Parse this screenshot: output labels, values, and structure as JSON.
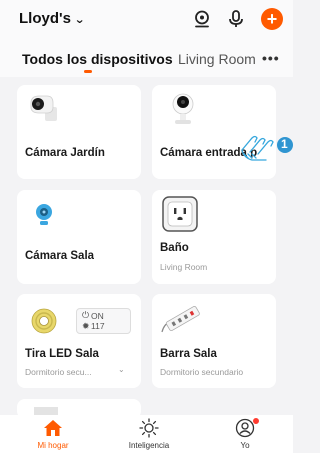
{
  "header": {
    "home_name": "Lloyd's",
    "icons": [
      "camera-icon",
      "mic-icon",
      "add-icon"
    ]
  },
  "tabs": [
    {
      "label": "Todos los dispositivos",
      "active": true
    },
    {
      "label": "Living Room",
      "active": false
    }
  ],
  "devices": [
    {
      "name": "Cámara Jardín",
      "room": "",
      "icon": "camera-outdoor-icon"
    },
    {
      "name": "Cámara entrada p",
      "room": "",
      "icon": "camera-indoor-icon"
    },
    {
      "name": "Cámara Sala",
      "room": "",
      "icon": "camera-dome-icon"
    },
    {
      "name": "Baño",
      "room": "Living Room",
      "icon": "smart-plug-icon"
    },
    {
      "name": "Tira LED Sala",
      "room": "Dormitorio secu...",
      "icon": "led-strip-icon",
      "status": "ON",
      "value": "117"
    },
    {
      "name": "Barra Sala",
      "room": "Dormitorio secundario",
      "icon": "power-strip-icon"
    }
  ],
  "hint": {
    "step": "1"
  },
  "bottom_nav": [
    {
      "label": "Mi hogar",
      "icon": "home-icon",
      "active": true
    },
    {
      "label": "Inteligencia",
      "icon": "sun-icon",
      "active": false
    },
    {
      "label": "Yo",
      "icon": "profile-icon",
      "active": false,
      "badge": true
    }
  ],
  "colors": {
    "accent": "#ff5a00",
    "background": "#f3f3f5",
    "card": "#ffffff"
  }
}
